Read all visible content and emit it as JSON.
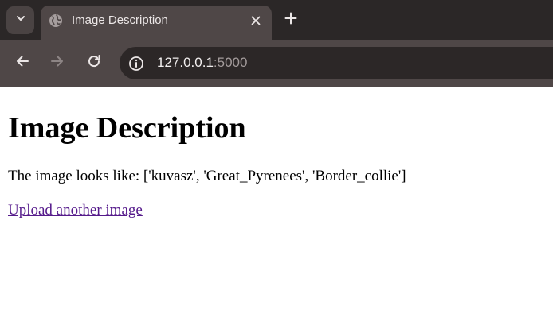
{
  "browser": {
    "tab": {
      "title": "Image Description"
    },
    "address_bar": {
      "host": "127.0.0.1",
      "port": ":5000"
    },
    "icons": {
      "tab_search": "chevron-down-icon",
      "favicon": "globe-icon",
      "tab_close": "close-icon",
      "new_tab": "plus-icon",
      "back": "arrow-left-icon",
      "forward": "arrow-right-icon",
      "reload": "reload-icon",
      "site_info": "info-icon"
    },
    "colors": {
      "tabstrip": "#2b2727",
      "active_tab": "#4f4747",
      "omnibox": "#2c2727"
    }
  },
  "page": {
    "heading": "Image Description",
    "description": "The image looks like: ['kuvasz', 'Great_Pyrenees', 'Border_collie']",
    "upload_link": "Upload another image",
    "colors": {
      "link_visited": "#551a8b"
    }
  }
}
